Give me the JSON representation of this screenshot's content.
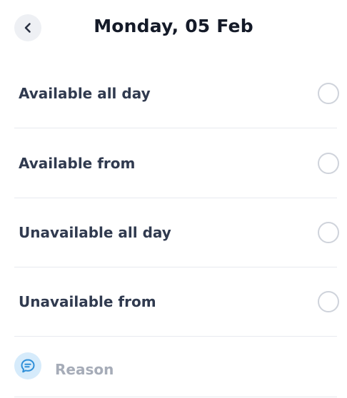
{
  "header": {
    "title": "Monday, 05 Feb",
    "back_icon": "chevron-left-icon"
  },
  "options": [
    {
      "label": "Available all day",
      "selected": false
    },
    {
      "label": "Available from",
      "selected": false
    },
    {
      "label": "Unavailable all day",
      "selected": false
    },
    {
      "label": "Unavailable from",
      "selected": false
    }
  ],
  "reason": {
    "placeholder": "Reason",
    "icon": "chat-bubble-icon"
  },
  "colors": {
    "title": "#141a28",
    "label": "#303a4f",
    "placeholder": "#a6acb8",
    "radio_border": "#cfd3db",
    "back_bg": "#eef0f4",
    "reason_icon_bg": "#d6ebfb",
    "reason_icon": "#2f8fd8",
    "divider": "#e8eaef"
  }
}
